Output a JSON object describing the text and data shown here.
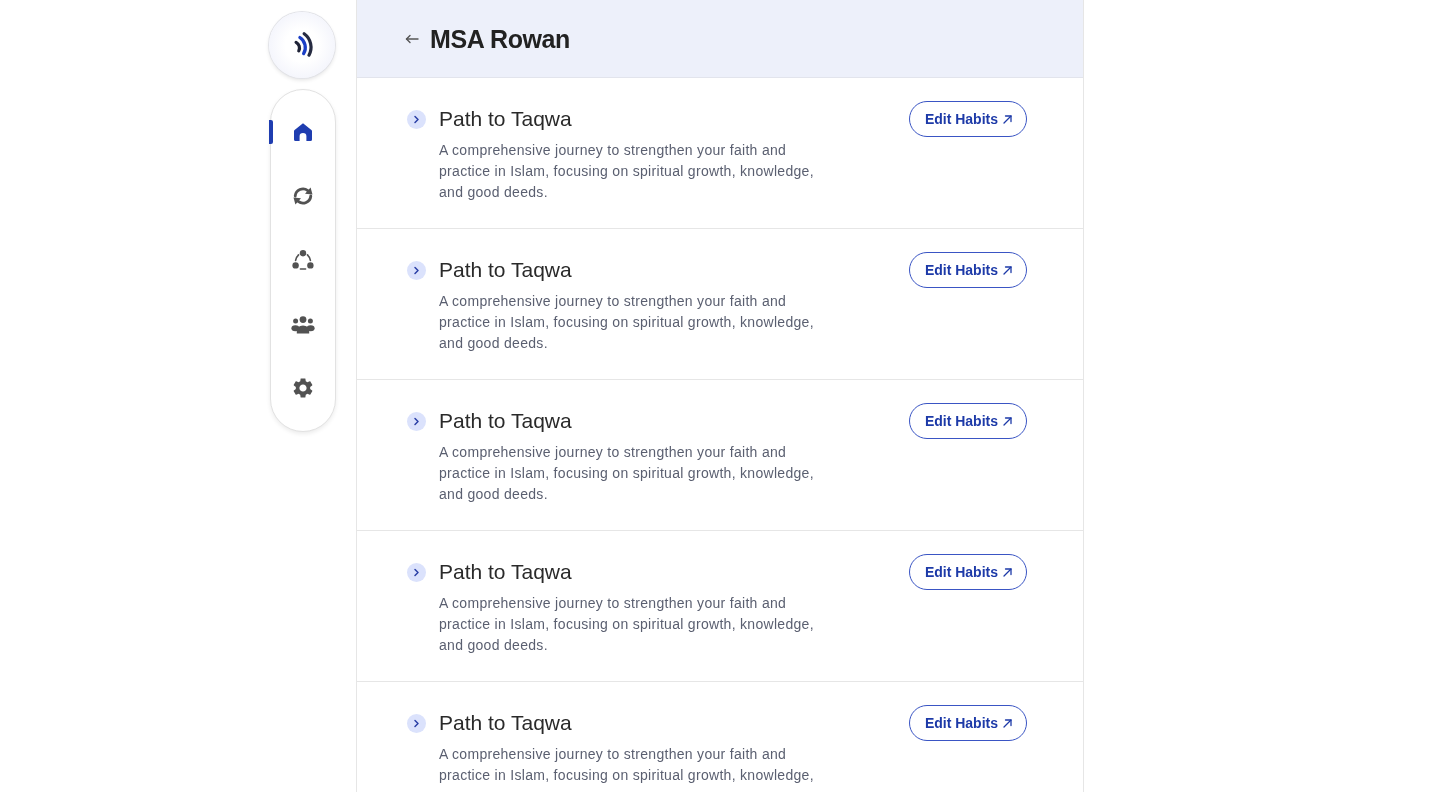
{
  "sidebar": {
    "nav_items": [
      {
        "kind": "home",
        "selected": true
      },
      {
        "kind": "sync",
        "selected": false
      },
      {
        "kind": "network",
        "selected": false
      },
      {
        "kind": "group",
        "selected": false
      },
      {
        "kind": "settings",
        "selected": false
      }
    ]
  },
  "header": {
    "title": "MSA Rowan"
  },
  "paths": [
    {
      "title": "Path to Taqwa",
      "description": "A comprehensive journey to strengthen your faith and practice in Islam, focusing on spiritual growth, knowledge, and good deeds.",
      "expanded": false,
      "button": "Edit Habits"
    },
    {
      "title": "Path to Taqwa",
      "description": "A comprehensive journey to strengthen your faith and practice in Islam, focusing on spiritual growth, knowledge, and good deeds.",
      "expanded": false,
      "button": "Edit Habits"
    },
    {
      "title": "Path to Taqwa",
      "description": "A comprehensive journey to strengthen your faith and practice in Islam, focusing on spiritual growth, knowledge, and good deeds.",
      "expanded": false,
      "button": "Edit Habits"
    },
    {
      "title": "Path to Taqwa",
      "description": "A comprehensive journey to strengthen your faith and practice in Islam, focusing on spiritual growth, knowledge, and good deeds.",
      "expanded": false,
      "button": "Edit Habits"
    },
    {
      "title": "Path to Taqwa",
      "description": "A comprehensive journey to strengthen your faith and practice in Islam, focusing on spiritual growth, knowledge,",
      "expanded": false,
      "button": "Edit Habits"
    }
  ]
}
